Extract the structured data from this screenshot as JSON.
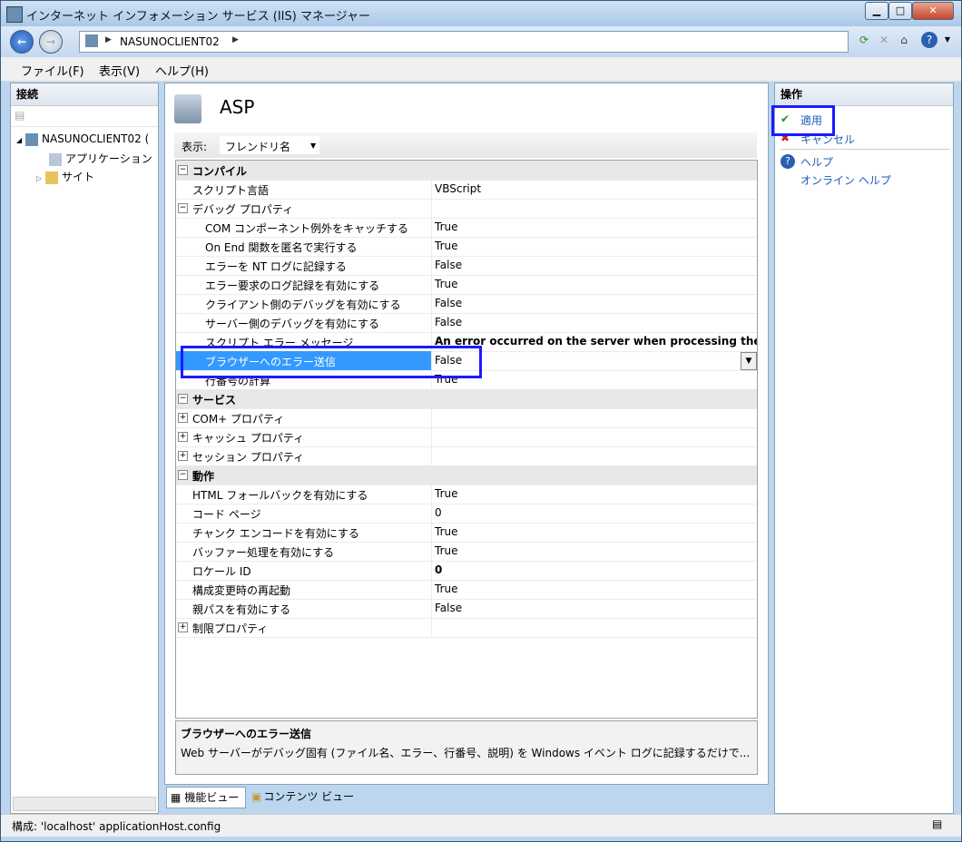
{
  "window": {
    "title": "インターネット インフォメーション サービス (IIS) マネージャー"
  },
  "address": {
    "segment": "NASUNOCLIENT02"
  },
  "menu": {
    "file": "ファイル(F)",
    "view": "表示(V)",
    "help": "ヘルプ(H)"
  },
  "connections": {
    "header": "接続",
    "tree": [
      {
        "label": "NASUNOCLIENT02 ("
      },
      {
        "label": "アプリケーション"
      },
      {
        "label": "サイト"
      }
    ]
  },
  "main": {
    "title": "ASP",
    "view_label": "表示:",
    "view_value": "フレンドリ名",
    "rows": [
      {
        "label": "コンパイル",
        "value": "",
        "type": "cat",
        "exp": "⊟"
      },
      {
        "label": "スクリプト言語",
        "value": "VBScript",
        "type": "item",
        "indent": 1
      },
      {
        "label": "デバッグ プロパティ",
        "value": "",
        "type": "group",
        "exp": "⊟",
        "indent": 1
      },
      {
        "label": "COM コンポーネント例外をキャッチする",
        "value": "True",
        "type": "item",
        "indent": 2
      },
      {
        "label": "On End 関数を匿名で実行する",
        "value": "True",
        "type": "item",
        "indent": 2
      },
      {
        "label": "エラーを NT ログに記録する",
        "value": "False",
        "type": "item",
        "indent": 2
      },
      {
        "label": "エラー要求のログ記録を有効にする",
        "value": "True",
        "type": "item",
        "indent": 2
      },
      {
        "label": "クライアント側のデバッグを有効にする",
        "value": "False",
        "type": "item",
        "indent": 2
      },
      {
        "label": "サーバー側のデバッグを有効にする",
        "value": "False",
        "type": "item",
        "indent": 2
      },
      {
        "label": "スクリプト エラー メッセージ",
        "value": "An error occurred on the server when processing the URL",
        "type": "item",
        "indent": 2,
        "bold": true
      },
      {
        "label": "ブラウザーへのエラー送信",
        "value": "False",
        "type": "selected",
        "indent": 2
      },
      {
        "label": "行番号の計算",
        "value": "True",
        "type": "item",
        "indent": 2
      },
      {
        "label": "サービス",
        "value": "",
        "type": "cat",
        "exp": "⊟"
      },
      {
        "label": "COM+ プロパティ",
        "value": "",
        "type": "group",
        "exp": "⊞",
        "indent": 1
      },
      {
        "label": "キャッシュ プロパティ",
        "value": "",
        "type": "group",
        "exp": "⊞",
        "indent": 1
      },
      {
        "label": "セッション プロパティ",
        "value": "",
        "type": "group",
        "exp": "⊞",
        "indent": 1
      },
      {
        "label": "動作",
        "value": "",
        "type": "cat",
        "exp": "⊟"
      },
      {
        "label": "HTML フォールバックを有効にする",
        "value": "True",
        "type": "item",
        "indent": 1
      },
      {
        "label": "コード ページ",
        "value": "0",
        "type": "item",
        "indent": 1
      },
      {
        "label": "チャンク エンコードを有効にする",
        "value": "True",
        "type": "item",
        "indent": 1
      },
      {
        "label": "バッファー処理を有効にする",
        "value": "True",
        "type": "item",
        "indent": 1
      },
      {
        "label": "ロケール ID",
        "value": "0",
        "type": "item",
        "indent": 1,
        "bold": true
      },
      {
        "label": "構成変更時の再起動",
        "value": "True",
        "type": "item",
        "indent": 1
      },
      {
        "label": "親パスを有効にする",
        "value": "False",
        "type": "item",
        "indent": 1
      },
      {
        "label": "制限プロパティ",
        "value": "",
        "type": "group",
        "exp": "⊞",
        "indent": 1
      }
    ],
    "desc_title": "ブラウザーへのエラー送信",
    "desc_body": "Web サーバーがデバッグ固有 (ファイル名、エラー、行番号、説明) を Windows イベント ログに記録するだけで..."
  },
  "view_tabs": {
    "features": "機能ビュー",
    "content": "コンテンツ ビュー"
  },
  "actions": {
    "header": "操作",
    "apply": "適用",
    "cancel": "キャンセル",
    "help": "ヘルプ",
    "online_help": "オンライン ヘルプ"
  },
  "status": {
    "text": "構成: 'localhost' applicationHost.config"
  },
  "colors": {
    "selection": "#3399ff",
    "highlight_box": "#1a1aff",
    "link": "#1a5fb4"
  }
}
